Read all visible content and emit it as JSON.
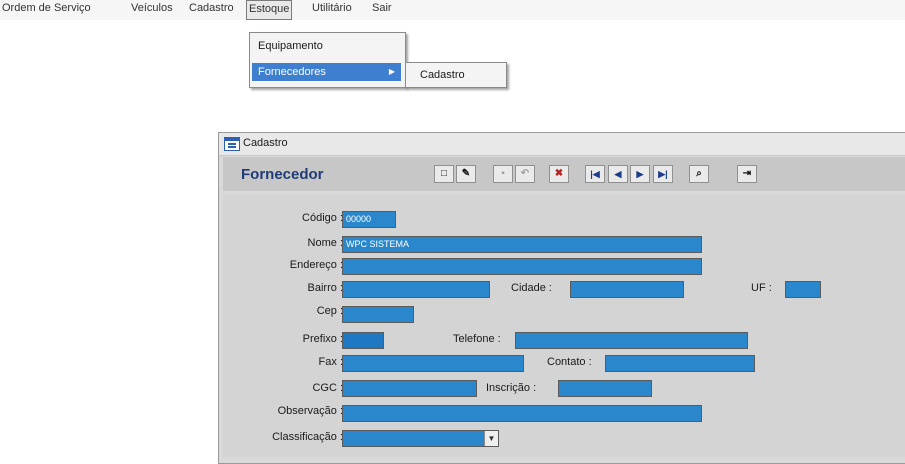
{
  "menubar": {
    "items": [
      "Ordem de Serviço",
      "Veículos",
      "Cadastro",
      "Estoque",
      "Utilitário",
      "Sair"
    ]
  },
  "estoque_menu": {
    "items": [
      "Equipamento",
      "Fornecedores"
    ]
  },
  "fornecedores_submenu": {
    "items": [
      "Cadastro"
    ]
  },
  "window": {
    "title": "Cadastro",
    "heading": "Fornecedor"
  },
  "toolbar": {
    "icons": [
      "new-icon",
      "edit-icon",
      "save-icon",
      "undo-icon",
      "delete-icon",
      "first-record-icon",
      "previous-record-icon",
      "next-record-icon",
      "last-record-icon",
      "search-icon",
      "exit-icon"
    ]
  },
  "form": {
    "labels": {
      "codigo": "Código :",
      "nome": "Nome :",
      "endereco": "Endereço :",
      "bairro": "Bairro :",
      "cidade": "Cidade :",
      "uf": "UF :",
      "cep": "Cep :",
      "prefixo": "Prefixo :",
      "telefone": "Telefone :",
      "fax": "Fax :",
      "contato": "Contato :",
      "cgc": "CGC :",
      "inscricao": "Inscrição :",
      "observacao": "Observação :",
      "classificacao": "Classificação :"
    },
    "values": {
      "codigo": "00000",
      "nome": "WPC SISTEMA",
      "endereco": "",
      "bairro": "",
      "cidade": "",
      "uf": "",
      "cep": "",
      "prefixo": "",
      "telefone": "",
      "fax": "",
      "contato": "",
      "cgc": "",
      "inscricao": "",
      "observacao": "",
      "classificacao": ""
    }
  },
  "colors": {
    "field_fill": "#2a87cc",
    "menu_highlight": "#3f7fd0",
    "heading": "#1f3c78"
  }
}
